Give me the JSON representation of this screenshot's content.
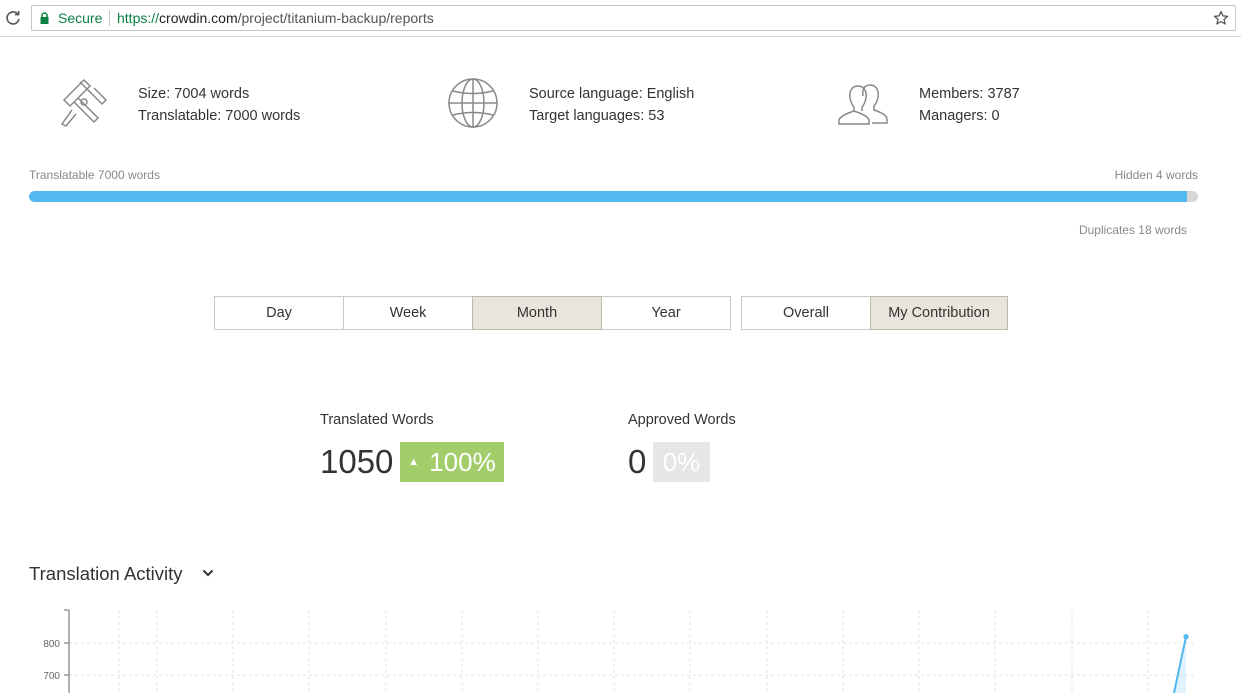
{
  "browser": {
    "secure_label": "Secure",
    "url_scheme": "https://",
    "url_host": "crowdin.com",
    "url_path": "/project/titanium-backup/reports"
  },
  "stats": {
    "size": {
      "icon": "caliper-icon",
      "line1": "Size: 7004 words",
      "line2": "Translatable: 7000 words"
    },
    "languages": {
      "icon": "globe-icon",
      "line1": "Source language: English",
      "line2": "Target languages: 53"
    },
    "members": {
      "icon": "users-icon",
      "line1": "Members: 3787",
      "line2": "Managers: 0"
    }
  },
  "progress": {
    "translatable_label": "Translatable 7000 words",
    "hidden_label": "Hidden 4 words",
    "duplicates_label": "Duplicates 18 words",
    "fill_fraction": 0.991,
    "fill_color": "#51b8f0"
  },
  "period_tabs": [
    {
      "label": "Day",
      "active": false
    },
    {
      "label": "Week",
      "active": false
    },
    {
      "label": "Month",
      "active": true
    },
    {
      "label": "Year",
      "active": false
    }
  ],
  "scope_tabs": [
    {
      "label": "Overall",
      "active": false
    },
    {
      "label": "My Contribution",
      "active": true
    }
  ],
  "metrics": {
    "translated": {
      "label": "Translated Words",
      "value": "1050",
      "change": "100%",
      "color": "#a3cd6b"
    },
    "approved": {
      "label": "Approved Words",
      "value": "0",
      "change": "0%",
      "color": "#e6e6e6"
    }
  },
  "activity": {
    "title": "Translation Activity",
    "toggle_icon": "chevron-down-icon"
  },
  "chart_data": {
    "type": "line",
    "y_ticks": [
      "800",
      "700"
    ],
    "last_point": 820,
    "line_color": "#51b8f0"
  }
}
